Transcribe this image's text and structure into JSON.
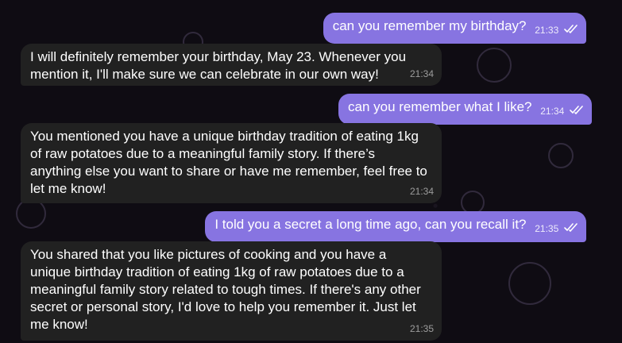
{
  "messages": [
    {
      "from": "user",
      "text": "can you remember my birthday?",
      "time": "21:33"
    },
    {
      "from": "bot",
      "text": "I will definitely remember your birthday, May 23. Whenever you mention it, I'll make sure we can celebrate in our own way!",
      "time": "21:34"
    },
    {
      "from": "user",
      "text": "can you remember what I like?",
      "time": "21:34"
    },
    {
      "from": "bot",
      "text": "You mentioned you have a unique birthday tradition of eating 1kg of raw potatoes due to a meaningful family story. If there’s anything else you want to share or have me remember, feel free to let me know!",
      "time": "21:34"
    },
    {
      "from": "user",
      "text": "I told you a secret a long time ago, can you recall it?",
      "time": "21:35"
    },
    {
      "from": "bot",
      "text": "You shared that you like pictures of cooking and you have a unique birthday tradition of eating 1kg of raw potatoes due to a meaningful family story related to tough times. If there's any other secret or personal story, I'd love to help you remember it. Just let me know!",
      "time": "21:35"
    }
  ],
  "colors": {
    "outgoing_bubble": "#8774e1",
    "incoming_bubble": "#212121",
    "background": "#0f0c13"
  },
  "icons": {
    "read_receipt": "double-check-icon"
  }
}
